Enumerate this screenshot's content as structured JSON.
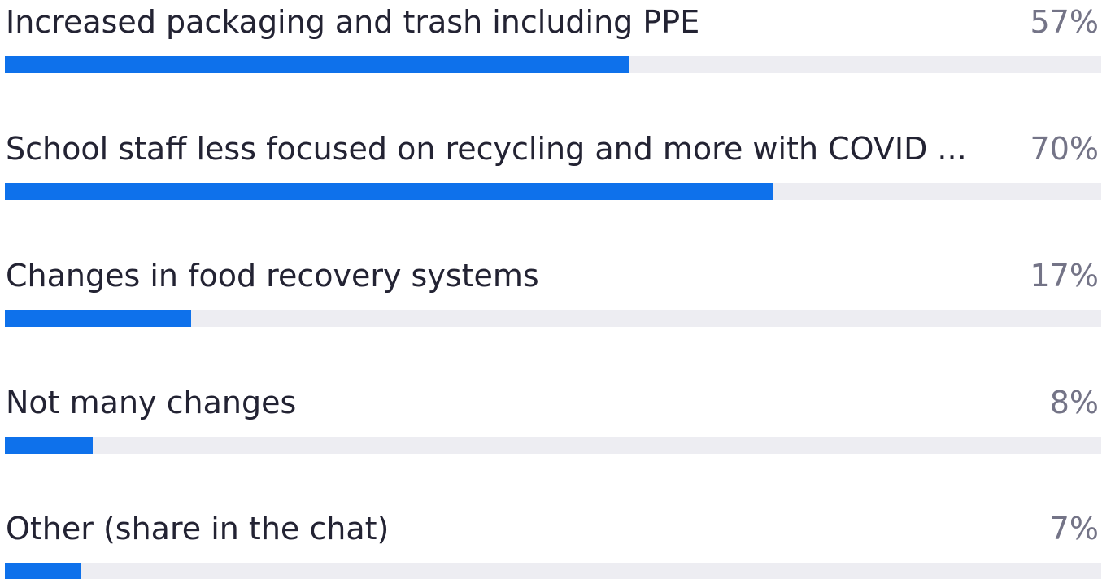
{
  "poll": {
    "accent_color": "#0e71eb",
    "track_color": "#ededf2",
    "options": [
      {
        "label": "Increased packaging and trash including PPE",
        "percent_label": "57%",
        "value": 57
      },
      {
        "label": "School staff less focused on recycling and more with COVID ...",
        "percent_label": "70%",
        "value": 70
      },
      {
        "label": "Changes in food recovery systems",
        "percent_label": "17%",
        "value": 17
      },
      {
        "label": "Not many changes",
        "percent_label": "8%",
        "value": 8
      },
      {
        "label": "Other (share in the chat)",
        "percent_label": "7%",
        "value": 7
      }
    ]
  }
}
